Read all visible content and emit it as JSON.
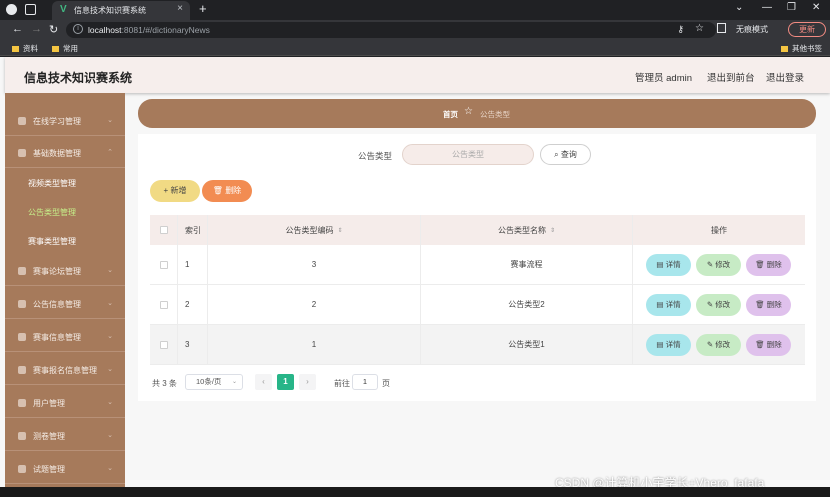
{
  "browser": {
    "tab_title": "信息技术知识赛系统",
    "url_host": "localhost",
    "url_rest": ":8081/#/dictionaryNews",
    "incognito_label": "无痕模式",
    "update_label": "更新",
    "bookmarks": [
      "资料",
      "常用"
    ],
    "other_bookmarks": "其他书签"
  },
  "header": {
    "title": "信息技术知识赛系统",
    "admin": "管理员 admin",
    "to_front": "退出到前台",
    "logout": "退出登录"
  },
  "sidebar": {
    "items": [
      {
        "label": "在线学习管理"
      },
      {
        "label": "基础数据管理"
      },
      {
        "label": "赛事论坛管理"
      },
      {
        "label": "公告信息管理"
      },
      {
        "label": "赛事信息管理"
      },
      {
        "label": "赛事报名信息管理"
      },
      {
        "label": "用户管理"
      },
      {
        "label": "测卷管理"
      },
      {
        "label": "试题管理"
      }
    ],
    "sub_items": [
      {
        "label": "视频类型管理"
      },
      {
        "label": "公告类型管理"
      },
      {
        "label": "赛事类型管理"
      }
    ]
  },
  "breadcrumb": {
    "home": "首页",
    "current": "公告类型"
  },
  "search": {
    "label": "公告类型",
    "placeholder": "公告类型",
    "query_button": "查询"
  },
  "actions": {
    "add": "新增",
    "delete": "删除"
  },
  "table": {
    "headers": {
      "index": "索引",
      "code": "公告类型编码",
      "name": "公告类型名称",
      "ops": "操作"
    },
    "rows": [
      {
        "index": "1",
        "code": "3",
        "name": "赛事流程"
      },
      {
        "index": "2",
        "code": "2",
        "name": "公告类型2"
      },
      {
        "index": "3",
        "code": "1",
        "name": "公告类型1"
      }
    ],
    "op_labels": {
      "detail": "详情",
      "edit": "修改",
      "delete": "删除"
    }
  },
  "pagination": {
    "total": "共 3 条",
    "page_size": "10条/页",
    "current_page": "1",
    "goto_label": "前往",
    "goto_value": "1",
    "page_unit": "页"
  },
  "watermark": "CSDN @计算机小宇学长+Vhero_fafafa"
}
